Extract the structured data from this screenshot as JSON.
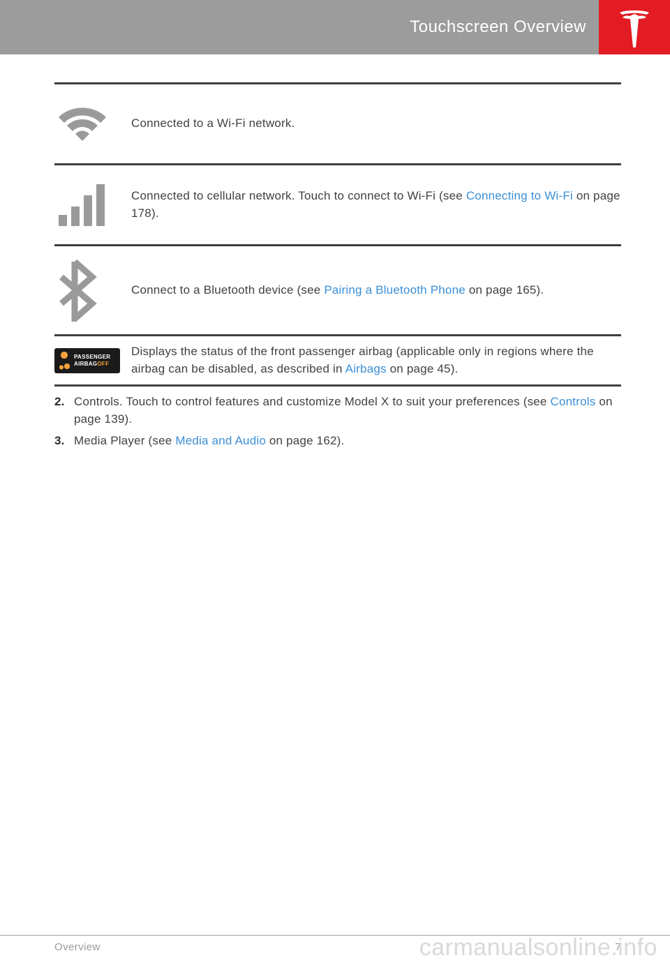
{
  "header": {
    "title": "Touchscreen Overview"
  },
  "rows": {
    "wifi": {
      "text": "Connected to a Wi-Fi network."
    },
    "cellular": {
      "pre": "Connected to cellular network. Touch to connect to Wi-Fi (see ",
      "link": "Connecting to Wi-Fi",
      "post": " on page 178)."
    },
    "bluetooth": {
      "pre": "Connect to a Bluetooth device (see ",
      "link": "Pairing a Bluetooth Phone",
      "post": " on page 165)."
    },
    "airbag": {
      "badge_line1": "PASSENGER",
      "badge_line2a": "AIRBAG",
      "badge_line2b": "OFF",
      "pre": "Displays the status of the front passenger airbag (applicable only in regions where the airbag can be disabled, as described in ",
      "link": "Airbags",
      "post": " on page 45)."
    }
  },
  "list": {
    "item2": {
      "num": "2.",
      "pre": "Controls. Touch to control features and customize Model X to suit your preferences (see ",
      "link": "Controls",
      "post": " on page 139)."
    },
    "item3": {
      "num": "3.",
      "pre": "Media Player (see ",
      "link": "Media and Audio",
      "post": " on page 162)."
    }
  },
  "footer": {
    "section": "Overview",
    "page": "7"
  },
  "watermark": "carmanualsonline.info"
}
